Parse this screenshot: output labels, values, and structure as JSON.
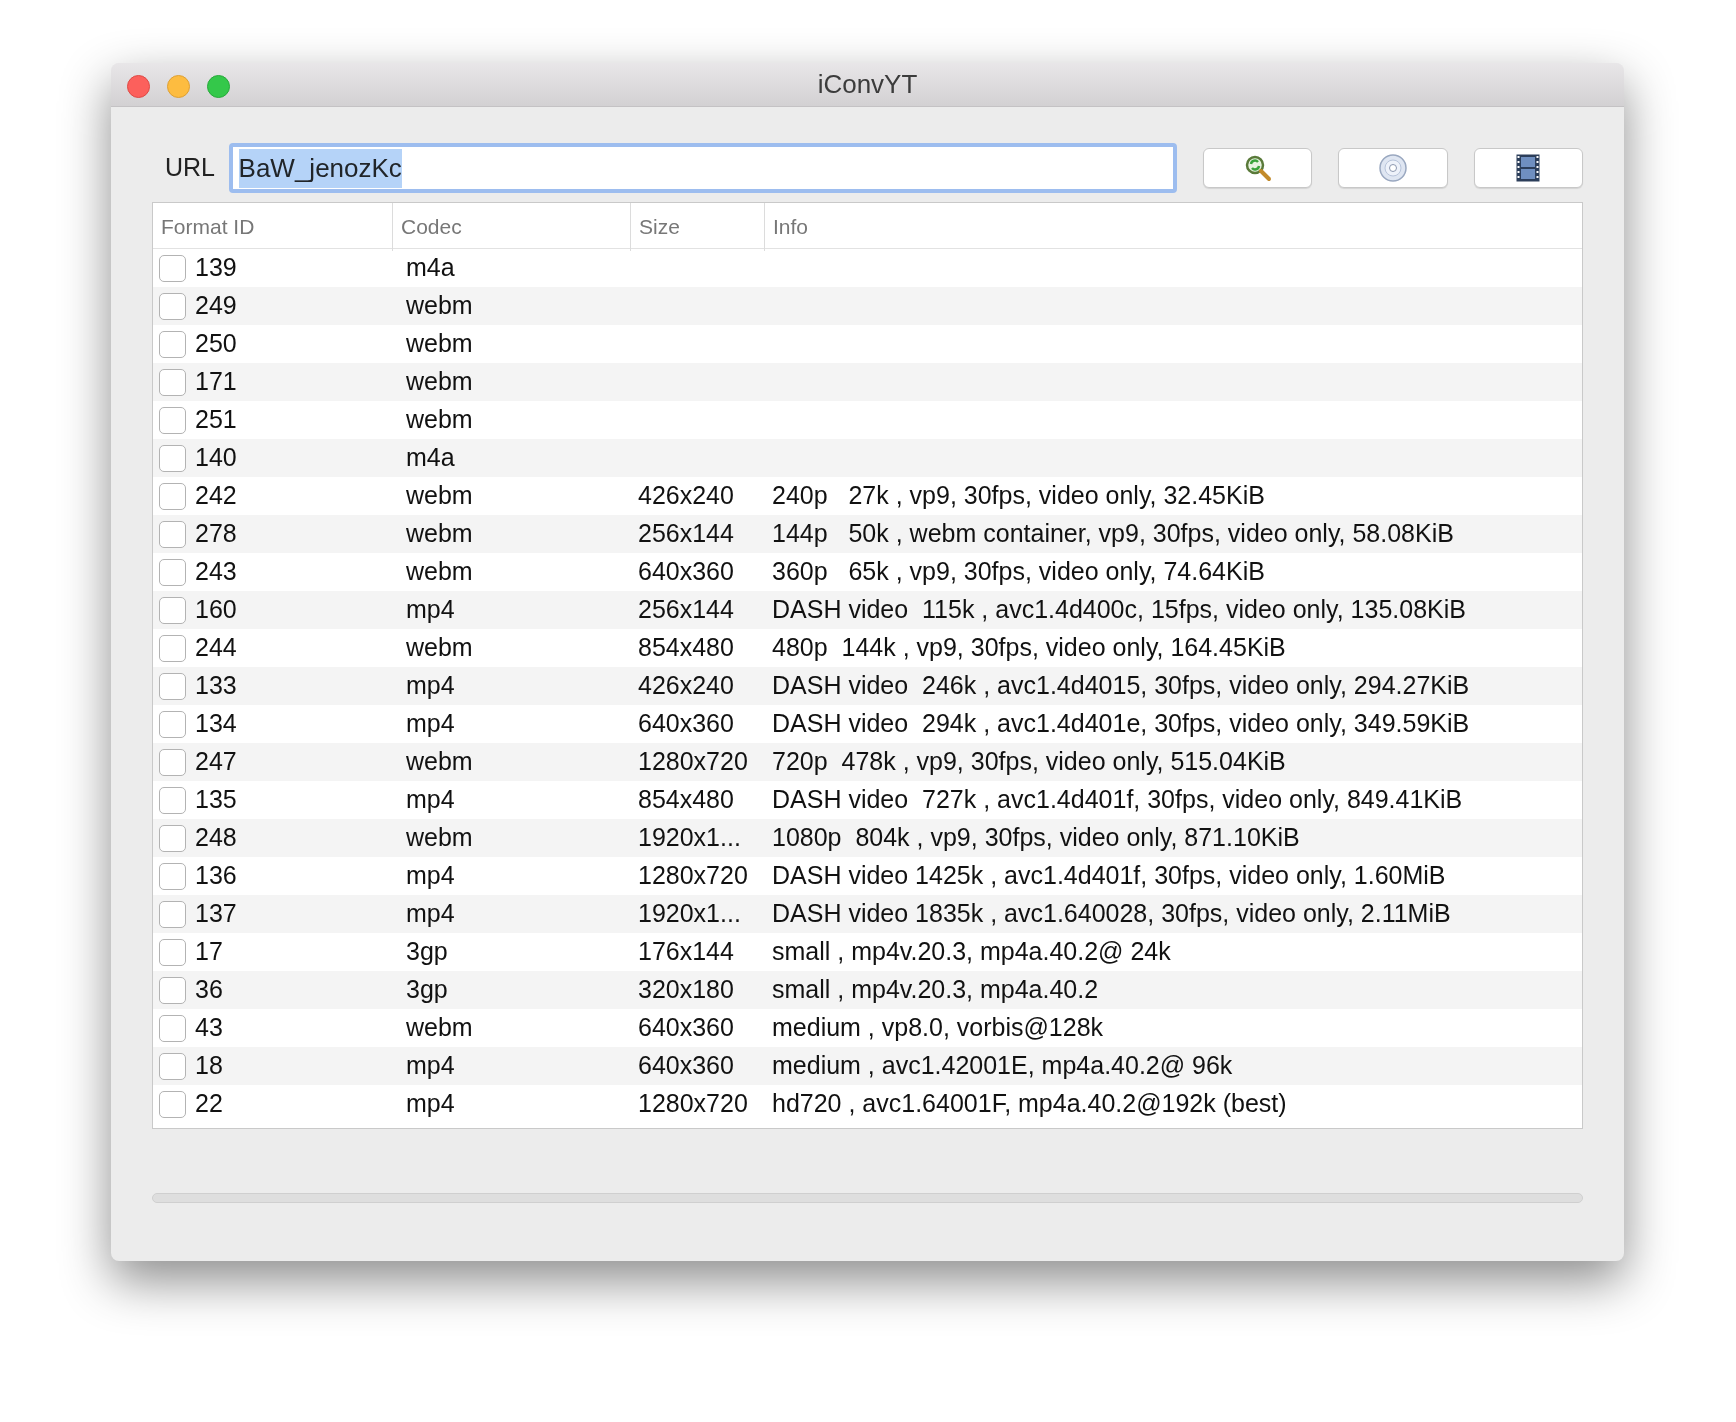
{
  "window": {
    "title": "iConvYT"
  },
  "url": {
    "label": "URL",
    "value": "BaW_jenozKc",
    "selected": true
  },
  "toolbar": [
    {
      "kind": "search"
    },
    {
      "kind": "disc"
    },
    {
      "kind": "film"
    }
  ],
  "table": {
    "columns": [
      "Format ID",
      "Codec",
      "Size",
      "Info"
    ],
    "rows": [
      {
        "id": "139",
        "codec": "m4a",
        "size": "",
        "info": "",
        "checked": false
      },
      {
        "id": "249",
        "codec": "webm",
        "size": "",
        "info": "",
        "checked": false
      },
      {
        "id": "250",
        "codec": "webm",
        "size": "",
        "info": "",
        "checked": false
      },
      {
        "id": "171",
        "codec": "webm",
        "size": "",
        "info": "",
        "checked": false
      },
      {
        "id": "251",
        "codec": "webm",
        "size": "",
        "info": "",
        "checked": false
      },
      {
        "id": "140",
        "codec": "m4a",
        "size": "",
        "info": "",
        "checked": false
      },
      {
        "id": "242",
        "codec": "webm",
        "size": "426x240",
        "info": "240p   27k , vp9, 30fps, video only, 32.45KiB",
        "checked": false
      },
      {
        "id": "278",
        "codec": "webm",
        "size": "256x144",
        "info": "144p   50k , webm container, vp9, 30fps, video only, 58.08KiB",
        "checked": false
      },
      {
        "id": "243",
        "codec": "webm",
        "size": "640x360",
        "info": "360p   65k , vp9, 30fps, video only, 74.64KiB",
        "checked": false
      },
      {
        "id": "160",
        "codec": "mp4",
        "size": "256x144",
        "info": "DASH video  115k , avc1.4d400c, 15fps, video only, 135.08KiB",
        "checked": false
      },
      {
        "id": "244",
        "codec": "webm",
        "size": "854x480",
        "info": "480p  144k , vp9, 30fps, video only, 164.45KiB",
        "checked": false
      },
      {
        "id": "133",
        "codec": "mp4",
        "size": "426x240",
        "info": "DASH video  246k , avc1.4d4015, 30fps, video only, 294.27KiB",
        "checked": false
      },
      {
        "id": "134",
        "codec": "mp4",
        "size": "640x360",
        "info": "DASH video  294k , avc1.4d401e, 30fps, video only, 349.59KiB",
        "checked": false
      },
      {
        "id": "247",
        "codec": "webm",
        "size": "1280x720",
        "info": "720p  478k , vp9, 30fps, video only, 515.04KiB",
        "checked": false
      },
      {
        "id": "135",
        "codec": "mp4",
        "size": "854x480",
        "info": "DASH video  727k , avc1.4d401f, 30fps, video only, 849.41KiB",
        "checked": false
      },
      {
        "id": "248",
        "codec": "webm",
        "size": "1920x1...",
        "info": "1080p  804k , vp9, 30fps, video only, 871.10KiB",
        "checked": false
      },
      {
        "id": "136",
        "codec": "mp4",
        "size": "1280x720",
        "info": "DASH video 1425k , avc1.4d401f, 30fps, video only, 1.60MiB",
        "checked": false
      },
      {
        "id": "137",
        "codec": "mp4",
        "size": "1920x1...",
        "info": "DASH video 1835k , avc1.640028, 30fps, video only, 2.11MiB",
        "checked": false
      },
      {
        "id": "17",
        "codec": "3gp",
        "size": "176x144",
        "info": "small , mp4v.20.3, mp4a.40.2@ 24k",
        "checked": false
      },
      {
        "id": "36",
        "codec": "3gp",
        "size": "320x180",
        "info": "small , mp4v.20.3, mp4a.40.2",
        "checked": false
      },
      {
        "id": "43",
        "codec": "webm",
        "size": "640x360",
        "info": "medium , vp8.0, vorbis@128k",
        "checked": false
      },
      {
        "id": "18",
        "codec": "mp4",
        "size": "640x360",
        "info": "medium , avc1.42001E, mp4a.40.2@ 96k",
        "checked": false
      },
      {
        "id": "22",
        "codec": "mp4",
        "size": "1280x720",
        "info": "hd720 , avc1.64001F, mp4a.40.2@192k (best)",
        "checked": false
      }
    ]
  },
  "progress": {
    "level": 0
  }
}
